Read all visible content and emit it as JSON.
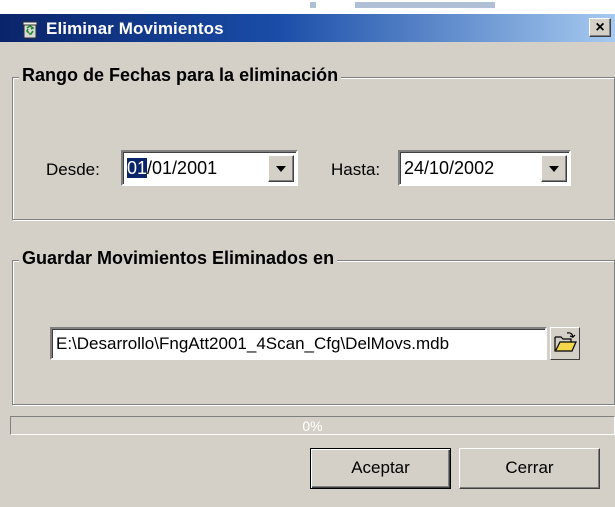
{
  "window": {
    "title": "Eliminar Movimientos",
    "close_label": "×",
    "icon": "recycle-bin-icon"
  },
  "date_range": {
    "legend": "Rango de Fechas para la eliminación",
    "from_label": "Desde:",
    "from_day": "01",
    "from_rest": "/01/2001",
    "to_label": "Hasta:",
    "to_value": "24/10/2002"
  },
  "save_location": {
    "legend": "Guardar Movimientos Eliminados en",
    "path": "E:\\Desarrollo\\FngAtt2001_4Scan_Cfg\\DelMovs.mdb",
    "browse_icon": "open-folder-icon"
  },
  "progress": {
    "value": 0,
    "text": "0%"
  },
  "buttons": {
    "accept": "Aceptar",
    "close": "Cerrar"
  },
  "colors": {
    "title_start": "#0a246a",
    "title_end": "#a6caf0",
    "face": "#d4d0c8",
    "selection": "#0a246a"
  }
}
